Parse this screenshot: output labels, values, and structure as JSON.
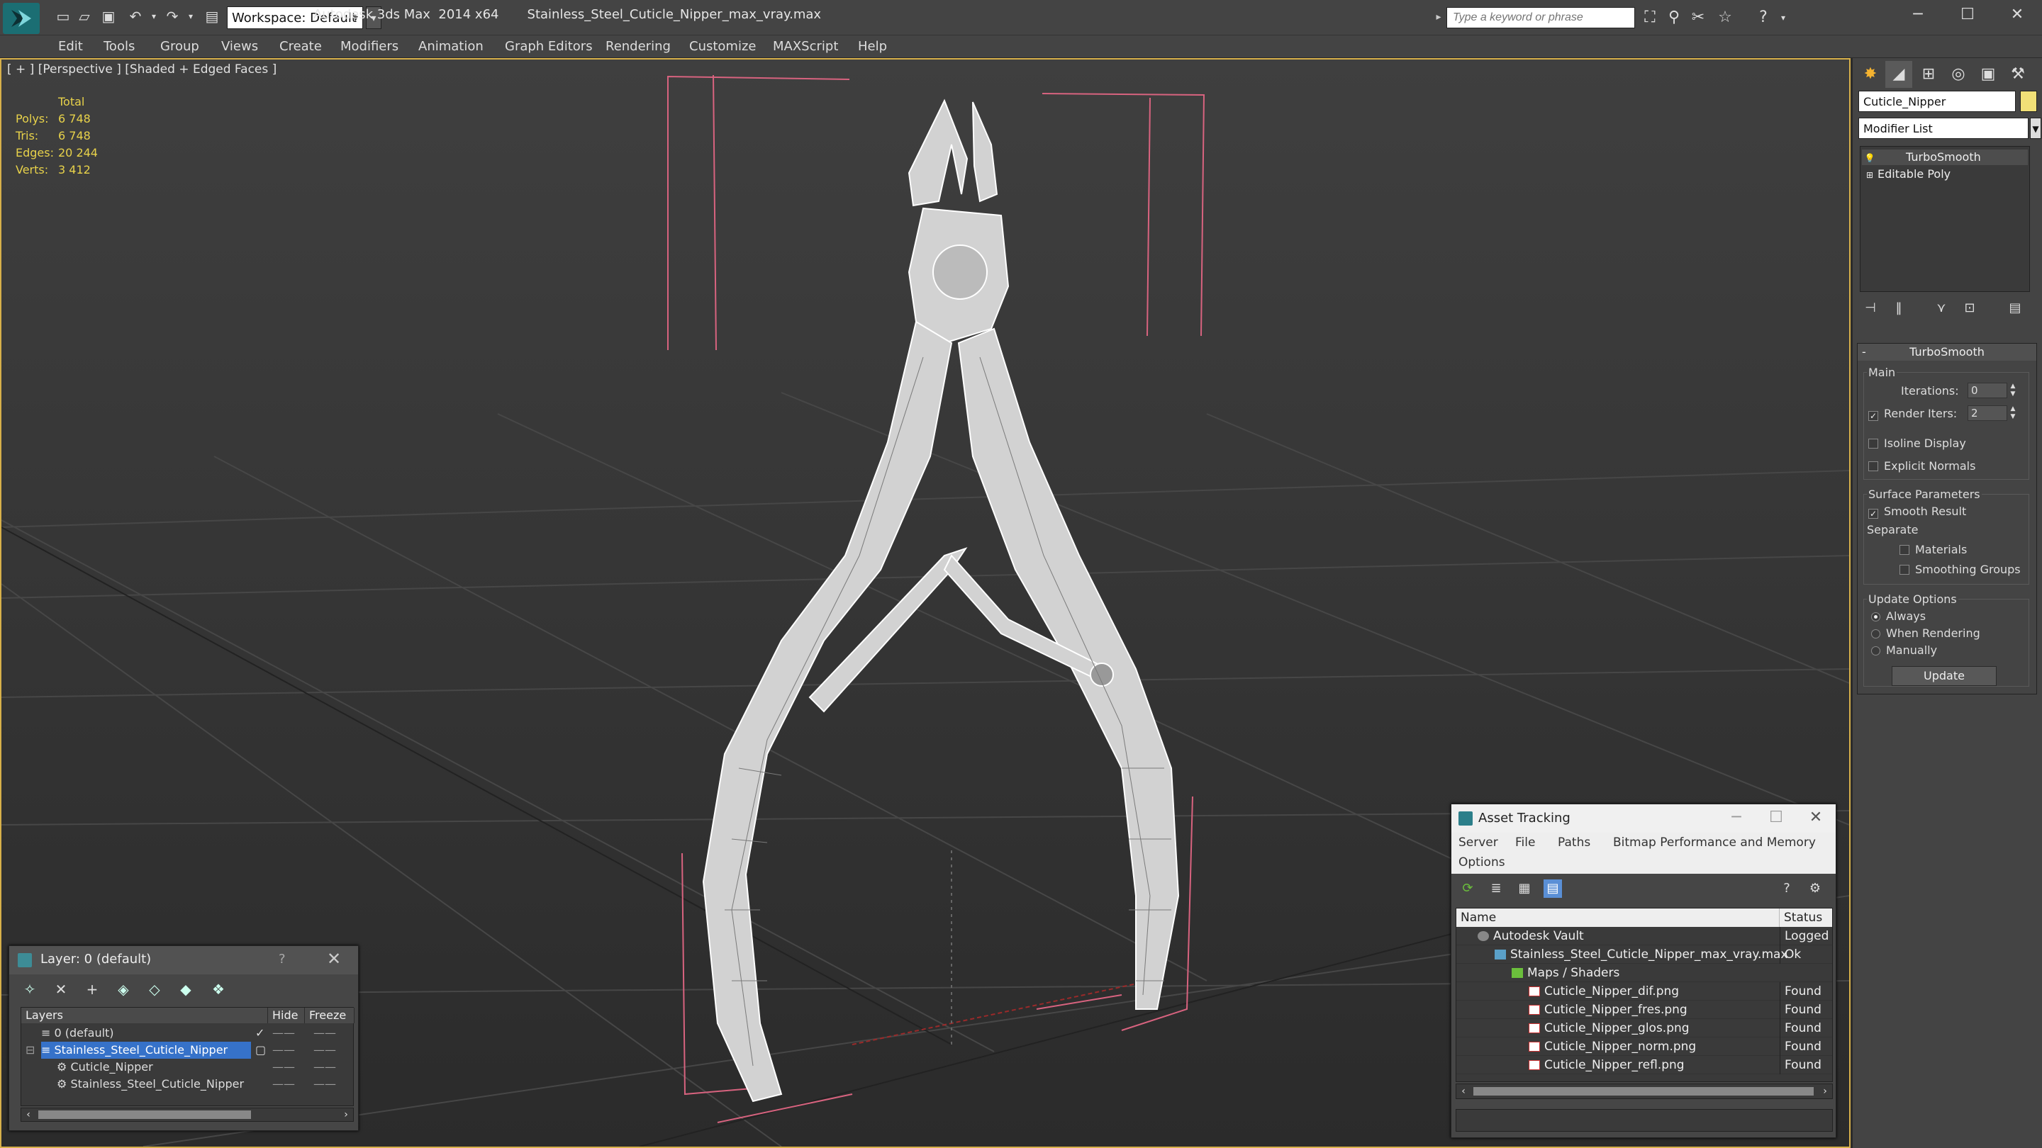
{
  "window": {
    "title": "Autodesk 3ds Max  2014 x64       Stainless_Steel_Cuticle_Nipper_max_vray.max",
    "workspace": "Workspace: Default",
    "search_placeholder": "Type a keyword or phrase"
  },
  "menu": [
    "Edit",
    "Tools",
    "Group",
    "Views",
    "Create",
    "Modifiers",
    "Animation",
    "Graph Editors",
    "Rendering",
    "Customize",
    "MAXScript",
    "Help"
  ],
  "viewport": {
    "label": "[ + ] [Perspective ] [Shaded + Edged Faces ]",
    "stats": {
      "header": "Total",
      "rows": [
        {
          "label": "Polys:",
          "value": "6 748"
        },
        {
          "label": "Tris:",
          "value": "6 748"
        },
        {
          "label": "Edges:",
          "value": "20 244"
        },
        {
          "label": "Verts:",
          "value": "3 412"
        }
      ]
    }
  },
  "command_panel": {
    "object_name": "Cuticle_Nipper",
    "object_color": "#f1e077",
    "modifier_list": "Modifier List",
    "stack": [
      "TurboSmooth",
      "Editable Poly"
    ],
    "rollout": {
      "title": "TurboSmooth",
      "main": {
        "title": "Main",
        "iterations_label": "Iterations:",
        "iterations": "0",
        "render_iters_label": "Render Iters:",
        "render_iters": "2",
        "isoline": "Isoline Display",
        "explicit_normals": "Explicit Normals"
      },
      "surface": {
        "title": "Surface Parameters",
        "smooth_result": "Smooth Result",
        "separate": "Separate",
        "materials": "Materials",
        "smoothing_groups": "Smoothing Groups"
      },
      "update": {
        "title": "Update Options",
        "always": "Always",
        "when_rendering": "When Rendering",
        "manually": "Manually",
        "button": "Update"
      }
    }
  },
  "layer_window": {
    "title": "Layer: 0 (default)",
    "help": "?",
    "columns": [
      "Layers",
      "Hide",
      "Freeze"
    ],
    "rows": [
      {
        "name": "0 (default)",
        "indent": 1
      },
      {
        "name": "Stainless_Steel_Cuticle_Nipper",
        "indent": 1,
        "selected": true
      },
      {
        "name": "Cuticle_Nipper",
        "indent": 2
      },
      {
        "name": "Stainless_Steel_Cuticle_Nipper",
        "indent": 2
      }
    ],
    "dash": "——"
  },
  "asset_window": {
    "title": "Asset Tracking",
    "menu": [
      "Server",
      "File",
      "Paths",
      "Bitmap Performance and Memory",
      "Options"
    ],
    "columns": [
      "Name",
      "Status"
    ],
    "rows": [
      {
        "name": "Autodesk Vault",
        "status": "Logged",
        "type": "vault"
      },
      {
        "name": "Stainless_Steel_Cuticle_Nipper_max_vray.max",
        "status": "Ok",
        "type": "file"
      },
      {
        "name": "Maps / Shaders",
        "status": "",
        "type": "folder"
      },
      {
        "name": "Cuticle_Nipper_dif.png",
        "status": "Found",
        "type": "png"
      },
      {
        "name": "Cuticle_Nipper_fres.png",
        "status": "Found",
        "type": "png"
      },
      {
        "name": "Cuticle_Nipper_glos.png",
        "status": "Found",
        "type": "png"
      },
      {
        "name": "Cuticle_Nipper_norm.png",
        "status": "Found",
        "type": "png"
      },
      {
        "name": "Cuticle_Nipper_refl.png",
        "status": "Found",
        "type": "png"
      }
    ]
  }
}
